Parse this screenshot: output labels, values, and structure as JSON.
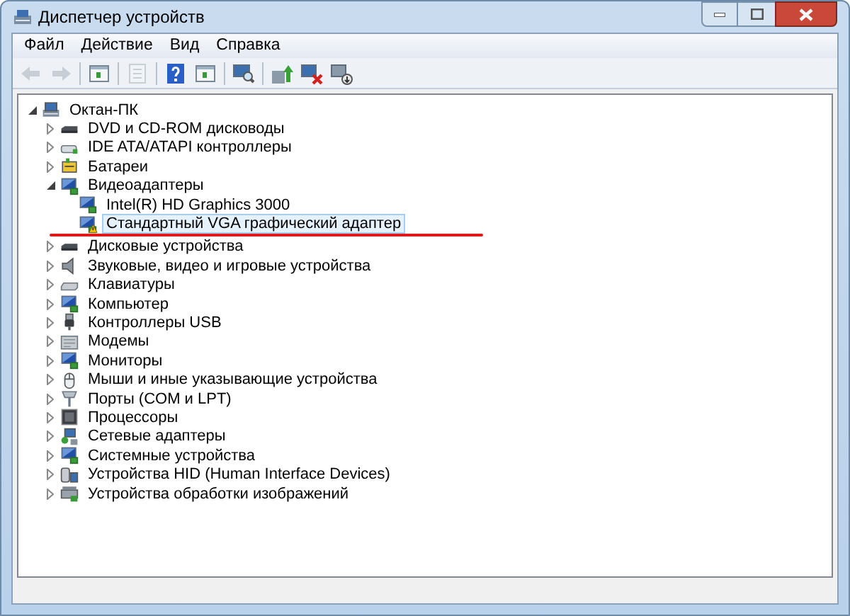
{
  "window": {
    "title": "Диспетчер устройств"
  },
  "menu": [
    "Файл",
    "Действие",
    "Вид",
    "Справка"
  ],
  "toolbar": [
    {
      "kind": "back",
      "disabled": true
    },
    {
      "kind": "forward",
      "disabled": true
    },
    {
      "kind": "sep"
    },
    {
      "kind": "pane",
      "disabled": false
    },
    {
      "kind": "sep"
    },
    {
      "kind": "props",
      "disabled": true
    },
    {
      "kind": "sep"
    },
    {
      "kind": "help",
      "disabled": false
    },
    {
      "kind": "pane",
      "disabled": false
    },
    {
      "kind": "sep"
    },
    {
      "kind": "scan",
      "disabled": false
    },
    {
      "kind": "sep"
    },
    {
      "kind": "update",
      "disabled": false
    },
    {
      "kind": "uninstall",
      "disabled": false
    },
    {
      "kind": "disable",
      "disabled": false
    }
  ],
  "tree": {
    "label": "Октан-ПК",
    "kind": "computer",
    "expanded": true,
    "selected": false,
    "children": [
      {
        "label": "DVD и CD-ROM дисководы",
        "kind": "drive",
        "expanded": false,
        "selected": false
      },
      {
        "label": "IDE ATA/ATAPI контроллеры",
        "kind": "controller",
        "expanded": false,
        "selected": false
      },
      {
        "label": "Батареи",
        "kind": "battery",
        "expanded": false,
        "selected": false
      },
      {
        "label": "Видеоадаптеры",
        "kind": "display",
        "expanded": true,
        "selected": false,
        "children": [
          {
            "label": "Intel(R) HD Graphics 3000",
            "kind": "display",
            "warning": false,
            "selected": false
          },
          {
            "label": "Стандартный VGA графический адаптер",
            "kind": "display",
            "warning": true,
            "selected": true
          }
        ]
      },
      {
        "label": "Дисковые устройства",
        "kind": "drive",
        "expanded": false,
        "selected": false
      },
      {
        "label": "Звуковые, видео и игровые устройства",
        "kind": "sound",
        "expanded": false,
        "selected": false
      },
      {
        "label": "Клавиатуры",
        "kind": "keyboard",
        "expanded": false,
        "selected": false
      },
      {
        "label": "Компьютер",
        "kind": "display",
        "expanded": false,
        "selected": false
      },
      {
        "label": "Контроллеры USB",
        "kind": "usb",
        "expanded": false,
        "selected": false
      },
      {
        "label": "Модемы",
        "kind": "modem",
        "expanded": false,
        "selected": false
      },
      {
        "label": "Мониторы",
        "kind": "display",
        "expanded": false,
        "selected": false
      },
      {
        "label": "Мыши и иные указывающие устройства",
        "kind": "mouse",
        "expanded": false,
        "selected": false
      },
      {
        "label": "Порты (COM и LPT)",
        "kind": "port",
        "expanded": false,
        "selected": false
      },
      {
        "label": "Процессоры",
        "kind": "cpu",
        "expanded": false,
        "selected": false
      },
      {
        "label": "Сетевые адаптеры",
        "kind": "network",
        "expanded": false,
        "selected": false
      },
      {
        "label": "Системные устройства",
        "kind": "display",
        "expanded": false,
        "selected": false
      },
      {
        "label": "Устройства HID (Human Interface Devices)",
        "kind": "hid",
        "expanded": false,
        "selected": false
      },
      {
        "label": "Устройства обработки изображений",
        "kind": "camera",
        "expanded": false,
        "selected": false
      }
    ]
  }
}
